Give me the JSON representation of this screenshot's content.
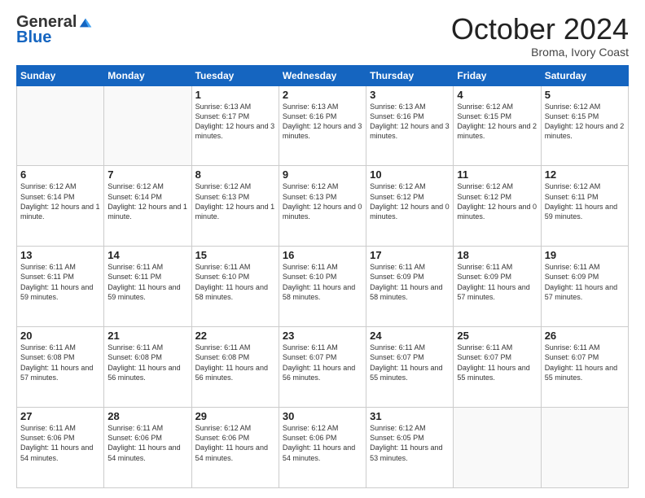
{
  "header": {
    "logo_general": "General",
    "logo_blue": "Blue",
    "month_title": "October 2024",
    "subtitle": "Broma, Ivory Coast"
  },
  "days_of_week": [
    "Sunday",
    "Monday",
    "Tuesday",
    "Wednesday",
    "Thursday",
    "Friday",
    "Saturday"
  ],
  "weeks": [
    [
      {
        "day": "",
        "info": ""
      },
      {
        "day": "",
        "info": ""
      },
      {
        "day": "1",
        "info": "Sunrise: 6:13 AM\nSunset: 6:17 PM\nDaylight: 12 hours and 3 minutes."
      },
      {
        "day": "2",
        "info": "Sunrise: 6:13 AM\nSunset: 6:16 PM\nDaylight: 12 hours and 3 minutes."
      },
      {
        "day": "3",
        "info": "Sunrise: 6:13 AM\nSunset: 6:16 PM\nDaylight: 12 hours and 3 minutes."
      },
      {
        "day": "4",
        "info": "Sunrise: 6:12 AM\nSunset: 6:15 PM\nDaylight: 12 hours and 2 minutes."
      },
      {
        "day": "5",
        "info": "Sunrise: 6:12 AM\nSunset: 6:15 PM\nDaylight: 12 hours and 2 minutes."
      }
    ],
    [
      {
        "day": "6",
        "info": "Sunrise: 6:12 AM\nSunset: 6:14 PM\nDaylight: 12 hours and 1 minute."
      },
      {
        "day": "7",
        "info": "Sunrise: 6:12 AM\nSunset: 6:14 PM\nDaylight: 12 hours and 1 minute."
      },
      {
        "day": "8",
        "info": "Sunrise: 6:12 AM\nSunset: 6:13 PM\nDaylight: 12 hours and 1 minute."
      },
      {
        "day": "9",
        "info": "Sunrise: 6:12 AM\nSunset: 6:13 PM\nDaylight: 12 hours and 0 minutes."
      },
      {
        "day": "10",
        "info": "Sunrise: 6:12 AM\nSunset: 6:12 PM\nDaylight: 12 hours and 0 minutes."
      },
      {
        "day": "11",
        "info": "Sunrise: 6:12 AM\nSunset: 6:12 PM\nDaylight: 12 hours and 0 minutes."
      },
      {
        "day": "12",
        "info": "Sunrise: 6:12 AM\nSunset: 6:11 PM\nDaylight: 11 hours and 59 minutes."
      }
    ],
    [
      {
        "day": "13",
        "info": "Sunrise: 6:11 AM\nSunset: 6:11 PM\nDaylight: 11 hours and 59 minutes."
      },
      {
        "day": "14",
        "info": "Sunrise: 6:11 AM\nSunset: 6:11 PM\nDaylight: 11 hours and 59 minutes."
      },
      {
        "day": "15",
        "info": "Sunrise: 6:11 AM\nSunset: 6:10 PM\nDaylight: 11 hours and 58 minutes."
      },
      {
        "day": "16",
        "info": "Sunrise: 6:11 AM\nSunset: 6:10 PM\nDaylight: 11 hours and 58 minutes."
      },
      {
        "day": "17",
        "info": "Sunrise: 6:11 AM\nSunset: 6:09 PM\nDaylight: 11 hours and 58 minutes."
      },
      {
        "day": "18",
        "info": "Sunrise: 6:11 AM\nSunset: 6:09 PM\nDaylight: 11 hours and 57 minutes."
      },
      {
        "day": "19",
        "info": "Sunrise: 6:11 AM\nSunset: 6:09 PM\nDaylight: 11 hours and 57 minutes."
      }
    ],
    [
      {
        "day": "20",
        "info": "Sunrise: 6:11 AM\nSunset: 6:08 PM\nDaylight: 11 hours and 57 minutes."
      },
      {
        "day": "21",
        "info": "Sunrise: 6:11 AM\nSunset: 6:08 PM\nDaylight: 11 hours and 56 minutes."
      },
      {
        "day": "22",
        "info": "Sunrise: 6:11 AM\nSunset: 6:08 PM\nDaylight: 11 hours and 56 minutes."
      },
      {
        "day": "23",
        "info": "Sunrise: 6:11 AM\nSunset: 6:07 PM\nDaylight: 11 hours and 56 minutes."
      },
      {
        "day": "24",
        "info": "Sunrise: 6:11 AM\nSunset: 6:07 PM\nDaylight: 11 hours and 55 minutes."
      },
      {
        "day": "25",
        "info": "Sunrise: 6:11 AM\nSunset: 6:07 PM\nDaylight: 11 hours and 55 minutes."
      },
      {
        "day": "26",
        "info": "Sunrise: 6:11 AM\nSunset: 6:07 PM\nDaylight: 11 hours and 55 minutes."
      }
    ],
    [
      {
        "day": "27",
        "info": "Sunrise: 6:11 AM\nSunset: 6:06 PM\nDaylight: 11 hours and 54 minutes."
      },
      {
        "day": "28",
        "info": "Sunrise: 6:11 AM\nSunset: 6:06 PM\nDaylight: 11 hours and 54 minutes."
      },
      {
        "day": "29",
        "info": "Sunrise: 6:12 AM\nSunset: 6:06 PM\nDaylight: 11 hours and 54 minutes."
      },
      {
        "day": "30",
        "info": "Sunrise: 6:12 AM\nSunset: 6:06 PM\nDaylight: 11 hours and 54 minutes."
      },
      {
        "day": "31",
        "info": "Sunrise: 6:12 AM\nSunset: 6:05 PM\nDaylight: 11 hours and 53 minutes."
      },
      {
        "day": "",
        "info": ""
      },
      {
        "day": "",
        "info": ""
      }
    ]
  ]
}
